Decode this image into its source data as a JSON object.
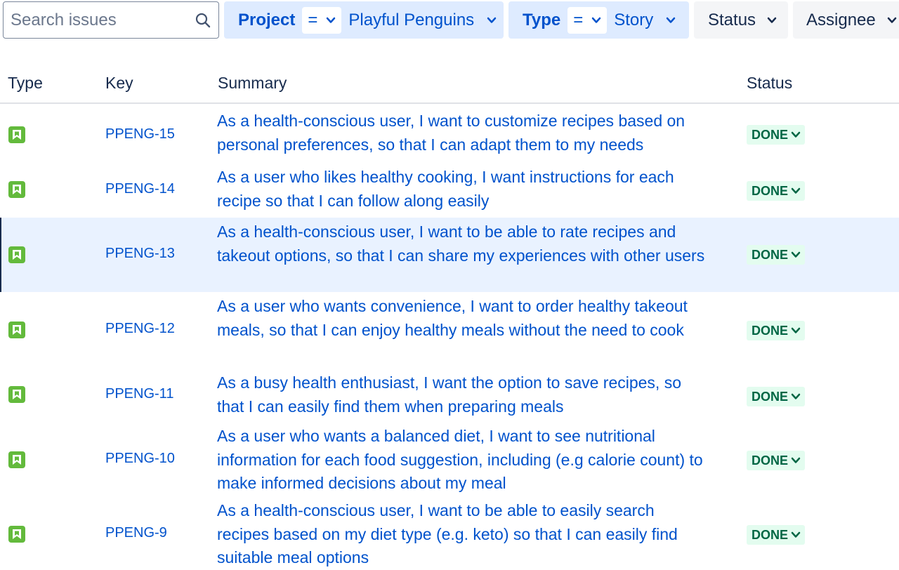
{
  "search": {
    "placeholder": "Search issues",
    "value": ""
  },
  "filters": {
    "project": {
      "label": "Project",
      "operator": "=",
      "value": "Playful Penguins"
    },
    "type": {
      "label": "Type",
      "operator": "=",
      "value": "Story"
    },
    "status": {
      "label": "Status"
    },
    "assignee": {
      "label": "Assignee"
    }
  },
  "table": {
    "columns": {
      "type": "Type",
      "key": "Key",
      "summary": "Summary",
      "status": "Status"
    },
    "rows": [
      {
        "type_icon": "story-icon",
        "key": "PPENG-15",
        "summary": "As a health-conscious user, I want to customize recipes based on personal preferences, so that I can adapt them to my needs",
        "status": "DONE"
      },
      {
        "type_icon": "story-icon",
        "key": "PPENG-14",
        "summary": "As a user who likes healthy cooking, I want instructions for each recipe so that I can follow along easily",
        "status": "DONE"
      },
      {
        "type_icon": "story-icon",
        "key": "PPENG-13",
        "summary": "As a health-conscious user, I want to be able to rate recipes and takeout options, so that I can share my experiences with other users",
        "status": "DONE"
      },
      {
        "type_icon": "story-icon",
        "key": "PPENG-12",
        "summary": "As a user who wants convenience, I want to order healthy takeout meals, so that I can enjoy healthy meals without the need to cook",
        "status": "DONE"
      },
      {
        "type_icon": "story-icon",
        "key": "PPENG-11",
        "summary": "As a busy health enthusiast, I want the option to save recipes, so that I can easily find them when preparing meals",
        "status": "DONE"
      },
      {
        "type_icon": "story-icon",
        "key": "PPENG-10",
        "summary": "As a user who wants a balanced diet, I want to see nutritional information for each food suggestion, including (e.g calorie count) to make informed decisions about my meal",
        "status": "DONE"
      },
      {
        "type_icon": "story-icon",
        "key": "PPENG-9",
        "summary": "As a health-conscious user, I want to be able to easily search recipes based on my diet type (e.g. keto) so that I can easily find suitable meal options",
        "status": "DONE"
      }
    ]
  },
  "colors": {
    "link": "#0052cc",
    "story": "#63ba3c",
    "done_bg": "#e3fcef",
    "done_text": "#006644",
    "selected_row": "#e9f2ff"
  }
}
